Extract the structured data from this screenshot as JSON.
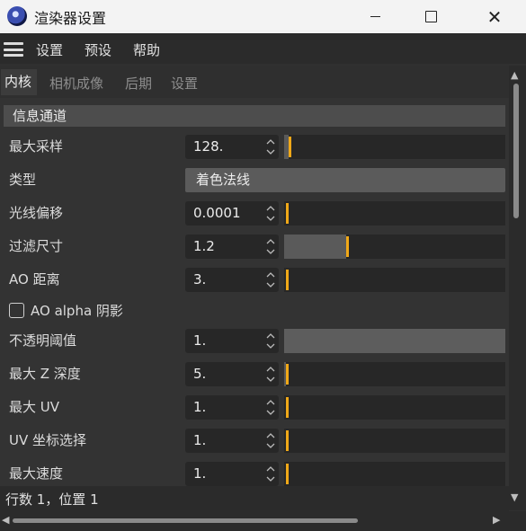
{
  "window": {
    "title": "渲染器设置",
    "app_icon": "cinema4d-logo-icon",
    "controls": {
      "minimize_icon": "minimize-icon",
      "maximize_icon": "maximize-icon",
      "close_icon": "close-icon",
      "close_glyph": "✕"
    }
  },
  "menubar": {
    "menu_icon": "hamburger-menu-icon",
    "items": [
      "设置",
      "预设",
      "帮助"
    ]
  },
  "tabs": [
    "内核",
    "相机成像",
    "后期",
    "设置"
  ],
  "active_tab": "内核",
  "section": {
    "title": "信息通道"
  },
  "parameters": [
    {
      "label": "最大采样",
      "value": "128.",
      "slider_level": 0.02
    },
    {
      "label": "类型",
      "dropdown": "着色法线"
    },
    {
      "label": "光线偏移",
      "value": "0.0001",
      "slider_level": 0.0
    },
    {
      "label": "过滤尺寸",
      "value": "1.2",
      "slider_level": 0.28
    },
    {
      "label": "AO 距离",
      "value": "3.",
      "slider_level": 0.0
    },
    {
      "label": "AO alpha 阴影",
      "checkbox": false
    },
    {
      "label": "不透明阈值",
      "value": "1.",
      "slider_disabled": true
    },
    {
      "label": "最大 Z 深度",
      "value": "5.",
      "slider_level": 0.01
    },
    {
      "label": "最大 UV",
      "value": "1.",
      "slider_level": 0.0
    },
    {
      "label": "UV 坐标选择",
      "value": "1.",
      "slider_level": 0.0
    },
    {
      "label": "最大速度",
      "value": "1.",
      "slider_level": 0.0
    }
  ],
  "status": {
    "text": "行数 1，位置 1"
  },
  "colors": {
    "accent": "#f0a818",
    "background": "#303030",
    "field": "#272727",
    "section": "#4d4d4d"
  }
}
